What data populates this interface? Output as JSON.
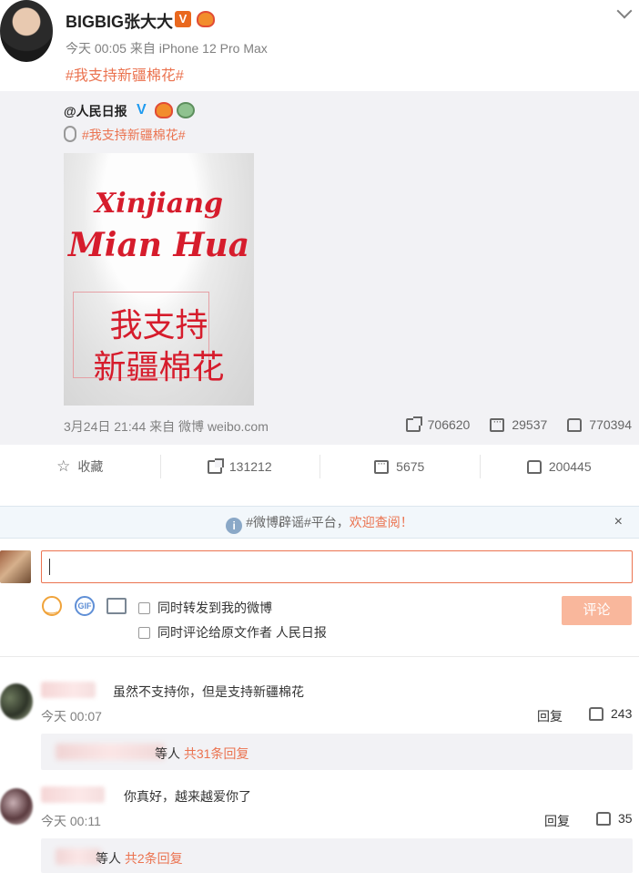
{
  "post": {
    "author": "BIGBIG张大大",
    "verified_badge": "V",
    "meta": "今天 00:05 来自 iPhone 12 Pro Max",
    "topic": "#我支持新疆棉花#"
  },
  "repost": {
    "author": "@人民日报",
    "verified_mark": "V",
    "topic": "#我支持新疆棉花#",
    "image_text": {
      "line1": "Xinjiang",
      "line2": "Mian Hua",
      "line3": "我支持",
      "line4": "新疆棉花"
    },
    "meta": "3月24日 21:44 来自 微博 weibo.com",
    "forwards": "706620",
    "comments": "29537",
    "likes": "770394"
  },
  "actions": {
    "favorite": "收藏",
    "forward": "131212",
    "comment": "5675",
    "like": "200445"
  },
  "notice": {
    "text": "#微博辟谣#平台，",
    "link": "欢迎查阅！",
    "close": "×"
  },
  "composer": {
    "input_value": "",
    "check_forward": "同时转发到我的微博",
    "check_comment_author": "同时评论给原文作者 人民日报",
    "submit": "评论"
  },
  "comments": [
    {
      "text": "虽然不支持你，但是支持新疆棉花",
      "time": "今天 00:07",
      "reply": "回复",
      "likes": "243",
      "sub_text_suffix": "等人",
      "sub_link": "共31条回复"
    },
    {
      "text": "你真好，越来越爱你了",
      "time": "今天 00:11",
      "reply": "回复",
      "likes": "35",
      "sub_text_suffix": "等人",
      "sub_link": "共2条回复"
    }
  ],
  "colors": {
    "accent": "#eb7350",
    "link_blue": "#1f9bf0",
    "image_red": "#d61c2c"
  }
}
